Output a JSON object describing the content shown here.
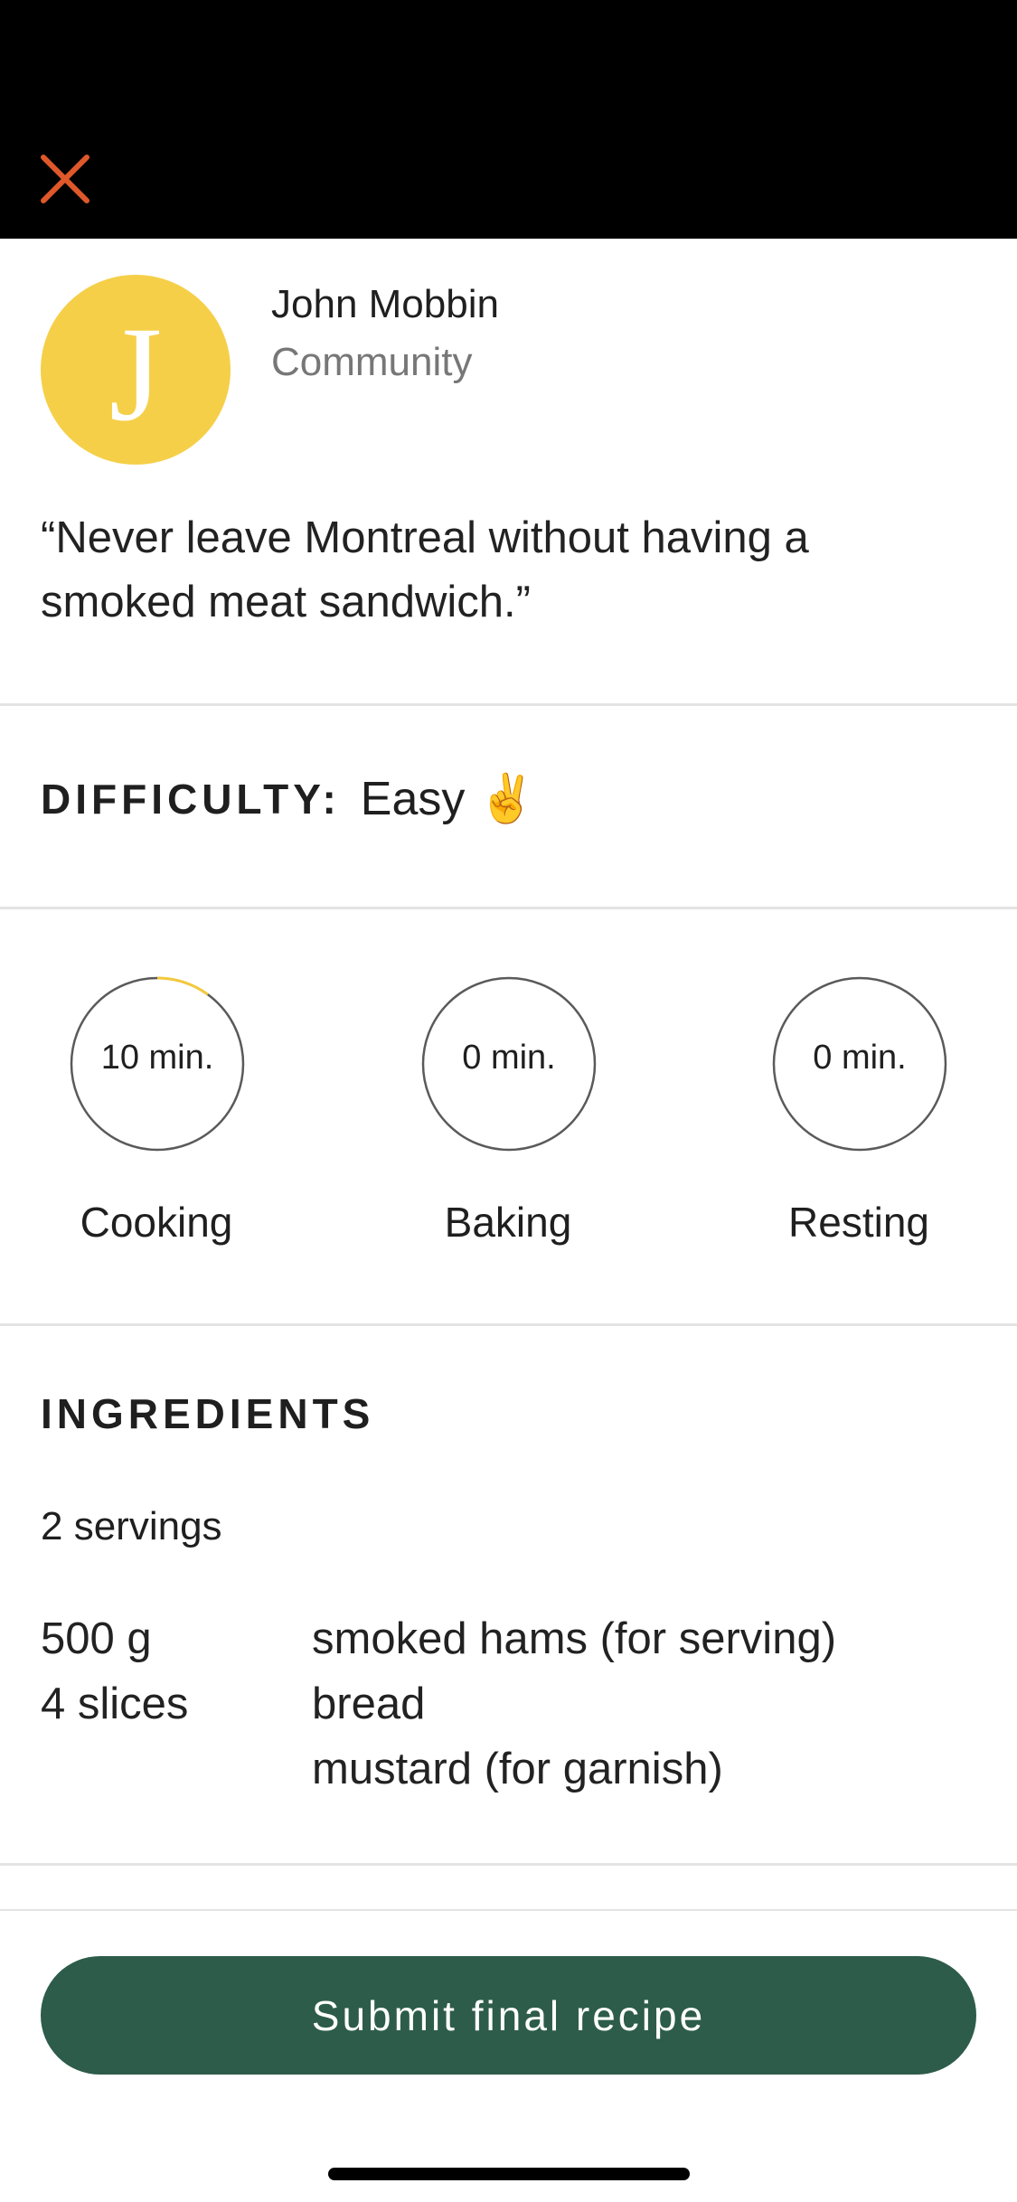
{
  "header": {
    "close_icon": "close-icon",
    "close_color": "#e0582a"
  },
  "author": {
    "avatar_initial": "J",
    "name": "John Mobbin",
    "role": "Community"
  },
  "quote": "“Never leave Montreal without having a smoked meat sandwich.”",
  "difficulty": {
    "label": "DIFFICULTY:",
    "value": "Easy",
    "emoji": "✌️"
  },
  "timers": [
    {
      "value": "10 min.",
      "label": "Cooking",
      "progress": 0.1
    },
    {
      "value": "0 min.",
      "label": "Baking",
      "progress": 0
    },
    {
      "value": "0 min.",
      "label": "Resting",
      "progress": 0
    }
  ],
  "ingredients": {
    "title": "INGREDIENTS",
    "servings": "2 servings",
    "items": [
      {
        "qty": "500 g",
        "name": "smoked hams (for serving)"
      },
      {
        "qty": "4 slices",
        "name": "bread"
      },
      {
        "qty": "",
        "name": "mustard (for garnish)"
      }
    ]
  },
  "submit": {
    "label": "Submit final recipe"
  },
  "colors": {
    "accent_orange": "#e0582a",
    "avatar_yellow": "#f6cf49",
    "progress_yellow": "#f3c93d",
    "button_green": "#2d5c4a"
  }
}
